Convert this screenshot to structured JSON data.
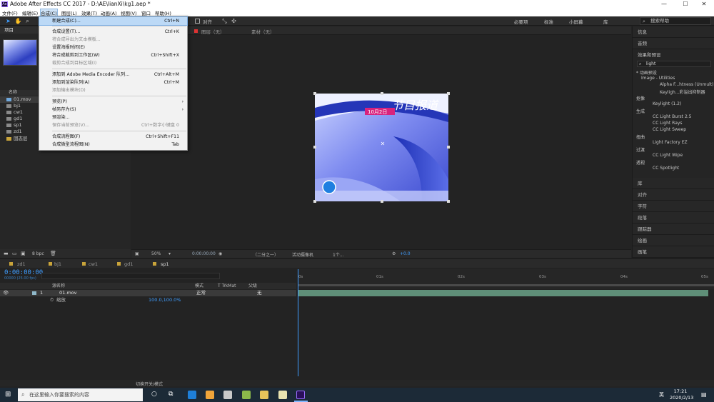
{
  "window": {
    "title": "Adobe After Effects CC 2017 - D:\\AE\\lianXi\\kg1.aep *",
    "minimize": "—",
    "maximize": "☐",
    "close": "✕"
  },
  "menubar": [
    "文件(F)",
    "编辑(E)",
    "合成(C)",
    "图层(L)",
    "效果(T)",
    "动画(A)",
    "视图(V)",
    "窗口",
    "帮助(H)"
  ],
  "toolbar": {
    "snap_label": "对齐",
    "workspaces": [
      "必要项",
      "标准",
      "小屏幕",
      "库"
    ],
    "search_placeholder": "搜索帮助"
  },
  "composition_menu": [
    {
      "label": "新建合成(C)...",
      "shortcut": "Ctrl+N",
      "state": "highlight"
    },
    {
      "label": "合成设置(T)...",
      "shortcut": "Ctrl+K",
      "state": "normal"
    },
    {
      "label": "将合成导出为文本模板...",
      "shortcut": "",
      "state": "disabled"
    },
    {
      "label": "设置海报时间(E)",
      "shortcut": "",
      "state": "normal"
    },
    {
      "label": "将合成裁剪到工作区(W)",
      "shortcut": "Ctrl+Shift+X",
      "state": "normal"
    },
    {
      "label": "裁剪合成到目标区域(I)",
      "shortcut": "",
      "state": "disabled"
    },
    {
      "label": "添加到 Adobe Media Encoder 队列...",
      "shortcut": "Ctrl+Alt+M",
      "state": "normal"
    },
    {
      "label": "添加到渲染队列(A)",
      "shortcut": "Ctrl+M",
      "state": "normal"
    },
    {
      "label": "添加输出模块(D)",
      "shortcut": "",
      "state": "disabled"
    },
    {
      "label": "预览(P)",
      "shortcut": "",
      "state": "submenu"
    },
    {
      "label": "帧另存为(S)",
      "shortcut": "",
      "state": "submenu"
    },
    {
      "label": "预渲染...",
      "shortcut": "",
      "state": "normal"
    },
    {
      "label": "保存当前预览(V)...",
      "shortcut": "Ctrl+数字小键盘 0",
      "state": "disabled"
    },
    {
      "label": "合成流程图(F)",
      "shortcut": "Ctrl+Shift+F11",
      "state": "normal"
    },
    {
      "label": "合成微型流程图(N)",
      "shortcut": "Tab",
      "state": "normal"
    }
  ],
  "project": {
    "tab": "项目",
    "columns": [
      "名称"
    ],
    "items": [
      {
        "name": "01.mov",
        "selected": true
      },
      {
        "name": "bj1",
        "selected": false
      },
      {
        "name": "cw1",
        "selected": false
      },
      {
        "name": "gd1",
        "selected": false
      },
      {
        "name": "sp1",
        "selected": false
      },
      {
        "name": "zd1",
        "selected": false
      },
      {
        "name": "固态层",
        "selected": false
      }
    ],
    "bpc": "8 bpc"
  },
  "viewer": {
    "tabs": [
      "图层（无）",
      "素材（无）"
    ],
    "zoom": "50%",
    "timecode": "0:00:00:00",
    "resolution": "（二分之一）",
    "camera": "活动摄像机",
    "views": "1个...",
    "exposure": "+0.0",
    "image_text": {
      "title": "节目报道",
      "date": "10月2日"
    }
  },
  "right_panels": {
    "top": [
      "信息",
      "音频"
    ],
    "effects_title": "效果和预设",
    "search_value": "light",
    "effects": [
      {
        "name": "* 动画预设",
        "level": 0
      },
      {
        "name": "Image - Utilities",
        "level": 1
      },
      {
        "name": "Alpha F...htness (Unmult)",
        "level": 2
      },
      {
        "name": "Keyligh...彩溢出抑制器",
        "level": 2
      },
      {
        "name": "抠像",
        "level": 0
      },
      {
        "name": "Keylight (1.2)",
        "level": 1
      },
      {
        "name": "生成",
        "level": 0
      },
      {
        "name": "CC Light Burst 2.5",
        "level": 1
      },
      {
        "name": "CC Light Rays",
        "level": 1
      },
      {
        "name": "CC Light Sweep",
        "level": 1
      },
      {
        "name": "扭曲",
        "level": 0
      },
      {
        "name": "Light Factory EZ",
        "level": 1
      },
      {
        "name": "过渡",
        "level": 0
      },
      {
        "name": "CC Light Wipe",
        "level": 1
      },
      {
        "name": "透视",
        "level": 0
      },
      {
        "name": "CC Spotlight",
        "level": 1
      }
    ],
    "bottom": [
      "库",
      "对齐",
      "字符",
      "段落",
      "跟踪器",
      "绘画",
      "画笔"
    ]
  },
  "timeline": {
    "tabs": [
      "zd1",
      "bj1",
      "cw1",
      "gd1",
      "sp1"
    ],
    "active_tab": "sp1",
    "timecode": "0:00:00:00",
    "fps": "00000 (25.00 fps)",
    "columns": {
      "source": "源名称",
      "mode": "模式",
      "trkmat": "T  TrkMat",
      "parent": "父级"
    },
    "layer": {
      "index": "1",
      "name": "01.mov",
      "mode": "正常",
      "parent": "无"
    },
    "property": {
      "name": "缩放",
      "value": "100.0,100.0%"
    },
    "ruler": [
      "0s",
      "01s",
      "02s",
      "03s",
      "04s",
      "05s"
    ],
    "footer": "切换开关/模式"
  },
  "taskbar": {
    "search_placeholder": "在这里输入你要搜索的内容",
    "time": "17:21",
    "date": "2020/2/13",
    "lang": "英"
  }
}
